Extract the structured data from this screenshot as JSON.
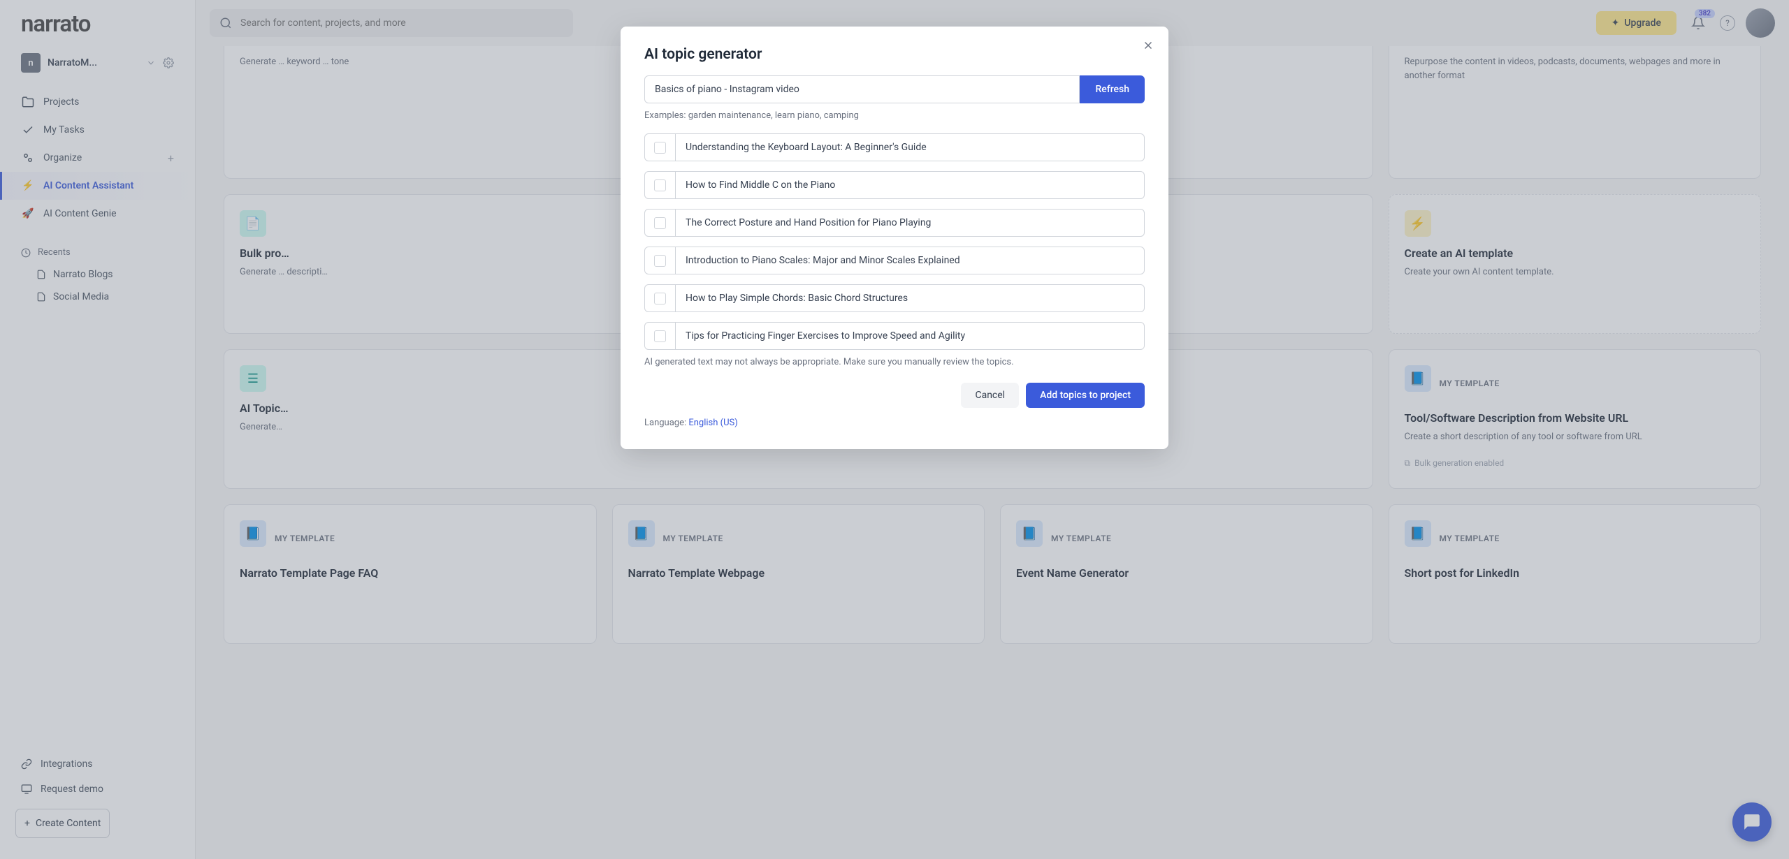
{
  "logo": "narrato",
  "workspace": {
    "badge": "n",
    "name": "NarratoM..."
  },
  "nav": {
    "projects": "Projects",
    "tasks": "My Tasks",
    "organize": "Organize",
    "ai_assistant": "AI Content Assistant",
    "ai_genie": "AI Content Genie"
  },
  "recents": {
    "header": "Recents",
    "items": [
      "Narrato Blogs",
      "Social Media"
    ]
  },
  "sidebar_footer": {
    "integrations": "Integrations",
    "request_demo": "Request demo",
    "create_content": "Create Content"
  },
  "topbar": {
    "search_placeholder": "Search for content, projects, and more",
    "upgrade": "Upgrade",
    "notif_count": "382"
  },
  "cards": {
    "partial1_desc": "Generate … keyword … tone",
    "partial2_desc": "Repurpose the content in videos, podcasts, documents, webpages and more in another format",
    "bulk_prod": {
      "title": "Bulk pro…",
      "desc": "Generate … descripti…"
    },
    "create_template": {
      "title": "Create an AI template",
      "desc": "Create your own AI content template."
    },
    "ai_topic": {
      "title": "AI Topic…",
      "desc": "Generate…"
    },
    "tool_desc": {
      "title": "Tool/Software Description from Website URL",
      "desc": "Create a short description of any tool or software from URL",
      "bulk": "Bulk generation enabled"
    },
    "template_label": "MY TEMPLATE",
    "narrato_faq": "Narrato Template Page FAQ",
    "narrato_webpage": "Narrato Template Webpage",
    "event_gen": "Event Name Generator",
    "linkedin": "Short post for LinkedIn"
  },
  "modal": {
    "title": "AI topic generator",
    "input_value": "Basics of piano - Instagram video",
    "refresh": "Refresh",
    "examples": "Examples: garden maintenance, learn piano, camping",
    "topics": [
      "Understanding the Keyboard Layout: A Beginner's Guide",
      "How to Find Middle C on the Piano",
      "The Correct Posture and Hand Position for Piano Playing",
      "Introduction to Piano Scales: Major and Minor Scales Explained",
      "How to Play Simple Chords: Basic Chord Structures",
      "Tips for Practicing Finger Exercises to Improve Speed and Agility"
    ],
    "disclaimer": "AI generated text may not always be appropriate. Make sure you manually review the topics.",
    "cancel": "Cancel",
    "add": "Add topics to project",
    "language_label": "Language: ",
    "language_value": "English (US)"
  }
}
